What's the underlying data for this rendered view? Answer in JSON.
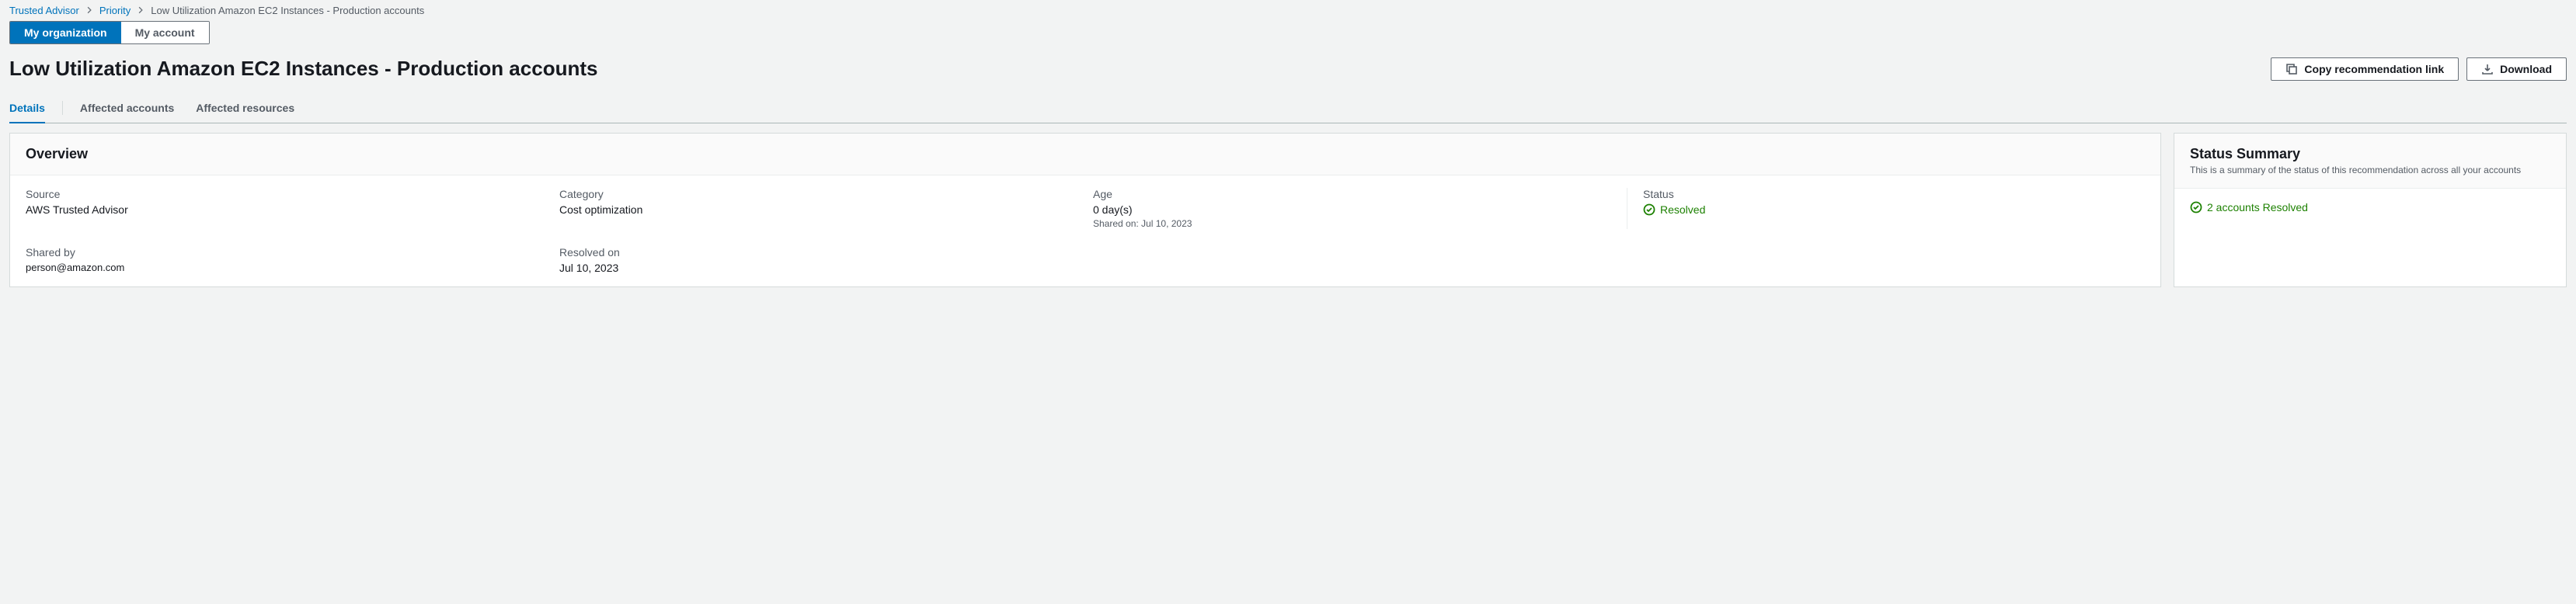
{
  "breadcrumb": {
    "item1": "Trusted Advisor",
    "item2": "Priority",
    "item3": "Low Utilization Amazon EC2 Instances - Production accounts"
  },
  "toggle": {
    "myorg": "My organization",
    "myacct": "My account"
  },
  "page_title": "Low Utilization Amazon EC2 Instances - Production accounts",
  "actions": {
    "copy": "Copy recommendation link",
    "download": "Download"
  },
  "tabs": {
    "details": "Details",
    "affected_accounts": "Affected accounts",
    "affected_resources": "Affected resources"
  },
  "overview": {
    "title": "Overview",
    "source": {
      "label": "Source",
      "value": "AWS Trusted Advisor"
    },
    "category": {
      "label": "Category",
      "value": "Cost optimization"
    },
    "age": {
      "label": "Age",
      "value": "0 day(s)",
      "sub": "Shared on: Jul 10, 2023"
    },
    "status": {
      "label": "Status",
      "value": "Resolved"
    },
    "shared_by": {
      "label": "Shared by",
      "value": "person@amazon.com"
    },
    "resolved_on": {
      "label": "Resolved on",
      "value": "Jul 10, 2023"
    }
  },
  "status_summary": {
    "title": "Status Summary",
    "sub": "This is a summary of the status of this recommendation across all your accounts",
    "line": "2 accounts Resolved"
  }
}
